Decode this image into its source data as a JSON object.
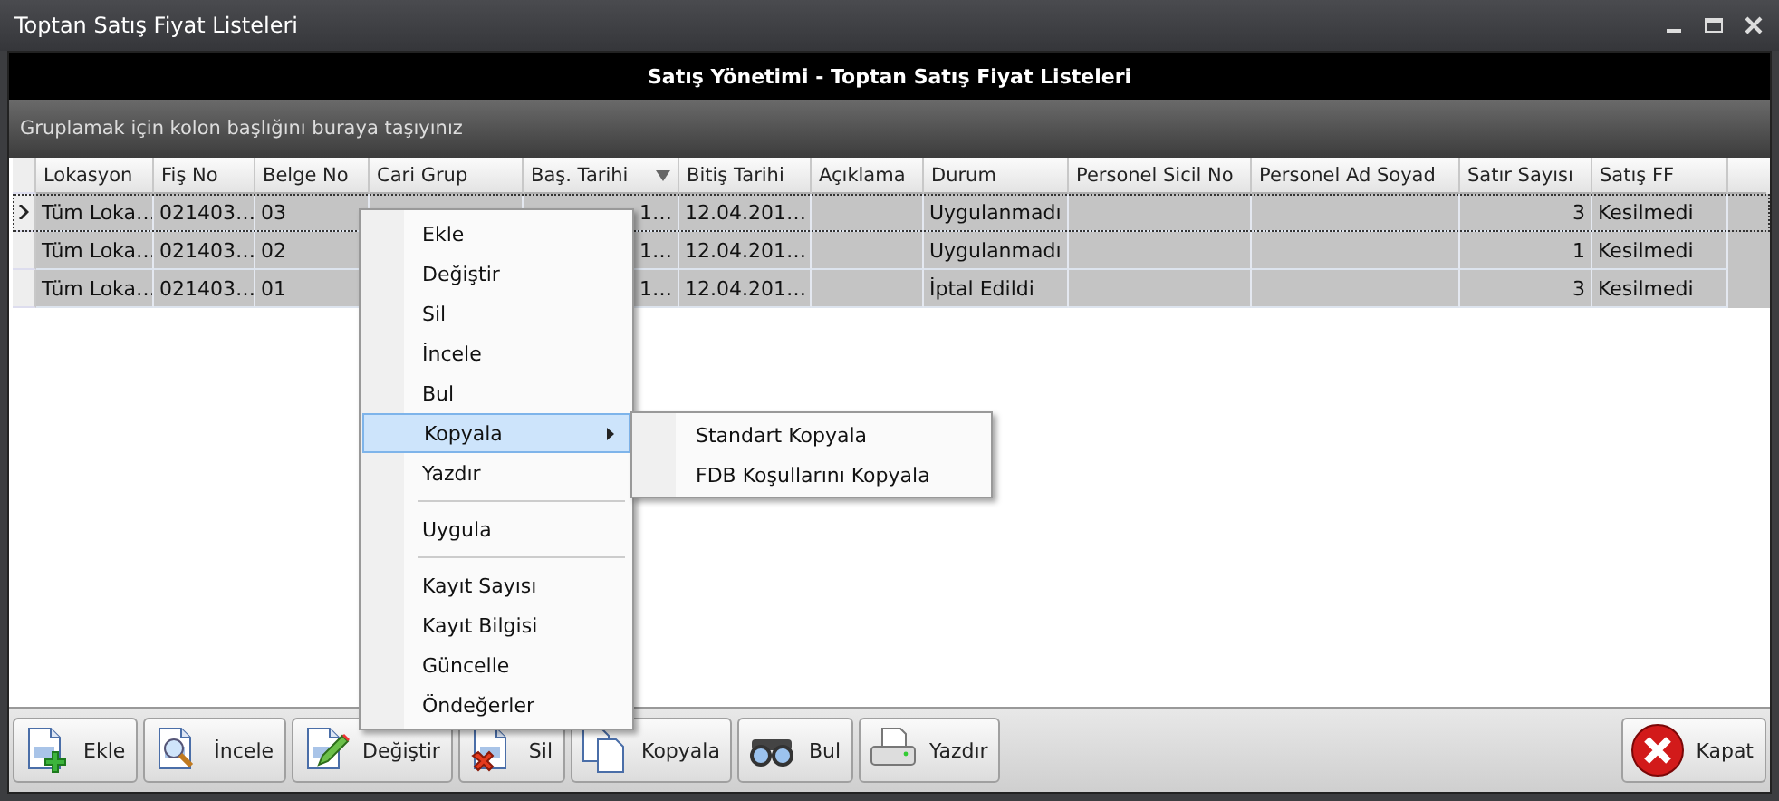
{
  "window": {
    "title": "Toptan Satış Fiyat Listeleri"
  },
  "header": {
    "title": "Satış Yönetimi - Toptan Satış Fiyat Listeleri"
  },
  "group_panel": {
    "hint": "Gruplamak için kolon başlığını buraya taşıyınız"
  },
  "table": {
    "columns": [
      {
        "label": "Lokasyon",
        "sorted": false,
        "kind": "text"
      },
      {
        "label": "Fiş No",
        "sorted": false,
        "kind": "text"
      },
      {
        "label": "Belge No",
        "sorted": false,
        "kind": "text"
      },
      {
        "label": "Cari Grup",
        "sorted": false,
        "kind": "text"
      },
      {
        "label": "Baş. Tarihi",
        "sorted": true,
        "kind": "clipped"
      },
      {
        "label": "Bitiş Tarihi",
        "sorted": false,
        "kind": "text"
      },
      {
        "label": "Açıklama",
        "sorted": false,
        "kind": "text"
      },
      {
        "label": "Durum",
        "sorted": false,
        "kind": "text"
      },
      {
        "label": "Personel Sicil No",
        "sorted": false,
        "kind": "text"
      },
      {
        "label": "Personel Ad Soyad",
        "sorted": false,
        "kind": "text"
      },
      {
        "label": "Satır Sayısı",
        "sorted": false,
        "kind": "number"
      },
      {
        "label": "Satış FF",
        "sorted": false,
        "kind": "text"
      }
    ],
    "rows": [
      {
        "selected": true,
        "cells": [
          "Tüm Loka…",
          "021403…",
          "03",
          "",
          "1…",
          "12.04.201…",
          "",
          "Uygulanmadı",
          "",
          "",
          "3",
          "Kesilmedi"
        ]
      },
      {
        "selected": false,
        "cells": [
          "Tüm Loka…",
          "021403…",
          "02",
          "",
          "1…",
          "12.04.201…",
          "",
          "Uygulanmadı",
          "",
          "",
          "1",
          "Kesilmedi"
        ]
      },
      {
        "selected": false,
        "cells": [
          "Tüm Loka…",
          "021403…",
          "01",
          "",
          "1…",
          "12.04.201…",
          "",
          "İptal Edildi",
          "",
          "",
          "3",
          "Kesilmedi"
        ]
      }
    ]
  },
  "context_menu": {
    "items": [
      {
        "kind": "item",
        "label": "Ekle",
        "selected": false
      },
      {
        "kind": "item",
        "label": "Değiştir",
        "selected": false
      },
      {
        "kind": "item",
        "label": "Sil",
        "selected": false
      },
      {
        "kind": "item",
        "label": "İncele",
        "selected": false
      },
      {
        "kind": "item",
        "label": "Bul",
        "selected": false
      },
      {
        "kind": "submenu",
        "label": "Kopyala",
        "selected": true
      },
      {
        "kind": "item",
        "label": "Yazdır",
        "selected": false
      },
      {
        "kind": "separator"
      },
      {
        "kind": "item",
        "label": "Uygula",
        "selected": false
      },
      {
        "kind": "separator"
      },
      {
        "kind": "item",
        "label": "Kayıt Sayısı",
        "selected": false
      },
      {
        "kind": "item",
        "label": "Kayıt Bilgisi",
        "selected": false
      },
      {
        "kind": "item",
        "label": "Güncelle",
        "selected": false
      },
      {
        "kind": "item",
        "label": "Öndeğerler",
        "selected": false
      }
    ],
    "submenu": [
      {
        "label": "Standart Kopyala",
        "selected": false
      },
      {
        "label": "FDB Koşullarını Kopyala",
        "selected": false
      }
    ]
  },
  "toolbar": [
    {
      "kind": "add",
      "label": "Ekle"
    },
    {
      "kind": "inspect",
      "label": "İncele"
    },
    {
      "kind": "edit",
      "label": "Değiştir"
    },
    {
      "kind": "delete",
      "label": "Sil"
    },
    {
      "kind": "copy",
      "label": "Kopyala"
    },
    {
      "kind": "find",
      "label": "Bul"
    },
    {
      "kind": "print",
      "label": "Yazdır"
    }
  ],
  "close_button": {
    "label": "Kapat"
  }
}
